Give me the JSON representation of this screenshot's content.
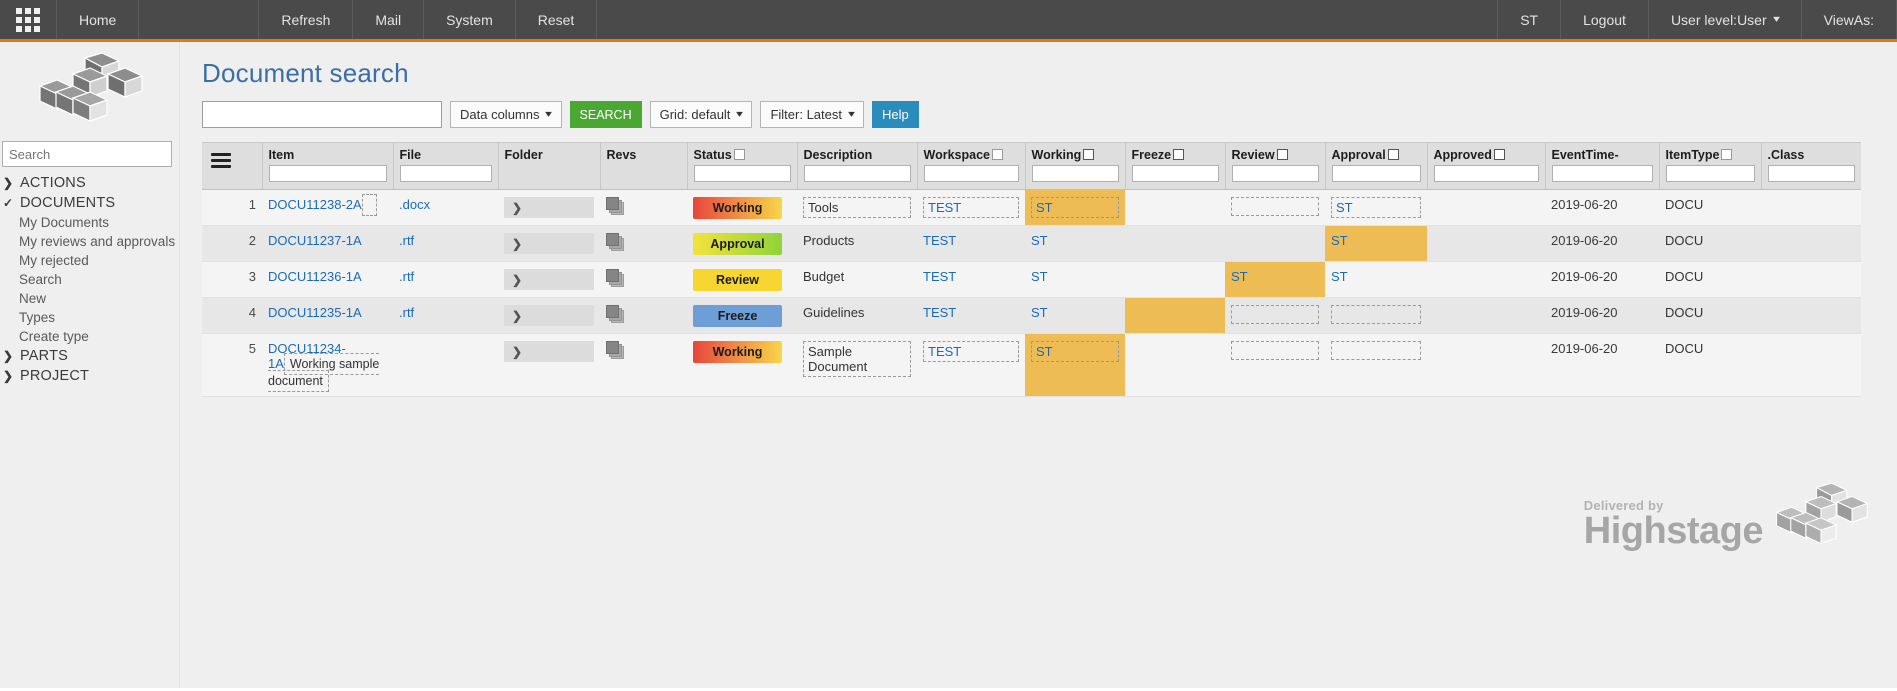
{
  "topbar": {
    "menu_icon": "grid-apps-icon",
    "items": [
      "Home",
      "Refresh",
      "Mail",
      "System",
      "Reset"
    ],
    "right_items": [
      "ST",
      "Logout"
    ],
    "user_level": "User level:User",
    "view_as": "ViewAs:"
  },
  "sidebar": {
    "logo": "highstage-cube-logo",
    "search_placeholder": "Search",
    "search_value": "",
    "groups": [
      {
        "label": "ACTIONS",
        "icon": "chevron-right-icon",
        "expanded": false,
        "items": []
      },
      {
        "label": "DOCUMENTS",
        "icon": "check-icon",
        "expanded": true,
        "items": [
          "My Documents",
          "My reviews and approvals",
          "My rejected",
          "Search",
          "New",
          "Types",
          "Create type"
        ]
      },
      {
        "label": "PARTS",
        "icon": "chevron-right-icon",
        "expanded": false,
        "items": []
      },
      {
        "label": "PROJECT",
        "icon": "chevron-right-icon",
        "expanded": false,
        "items": []
      }
    ]
  },
  "page": {
    "title": "Document search"
  },
  "toolbar": {
    "search_value": "",
    "search_placeholder": "",
    "data_columns": "Data columns",
    "search_button": "SEARCH",
    "grid": "Grid: default",
    "filter": "Filter: Latest",
    "help": "Help"
  },
  "grid": {
    "menu_icon": "hamburger-menu-icon",
    "columns": [
      {
        "label": "Item",
        "checkbox": "none",
        "filter": ""
      },
      {
        "label": "File",
        "checkbox": "none",
        "filter": ""
      },
      {
        "label": "Folder",
        "checkbox": "none",
        "filter": null
      },
      {
        "label": "Revs",
        "checkbox": "none",
        "filter": null
      },
      {
        "label": "Status",
        "checkbox": "small",
        "filter": ""
      },
      {
        "label": "Description",
        "checkbox": "none",
        "filter": ""
      },
      {
        "label": "Workspace",
        "checkbox": "small",
        "filter": ""
      },
      {
        "label": "Working",
        "checkbox": "big",
        "filter": ""
      },
      {
        "label": "Freeze",
        "checkbox": "big",
        "filter": ""
      },
      {
        "label": "Review",
        "checkbox": "big",
        "filter": ""
      },
      {
        "label": "Approval",
        "checkbox": "big",
        "filter": ""
      },
      {
        "label": "Approved",
        "checkbox": "big",
        "filter": ""
      },
      {
        "label": "EventTime-",
        "checkbox": "none",
        "filter": ""
      },
      {
        "label": "ItemType",
        "checkbox": "small",
        "filter": ""
      },
      {
        "label": ".Class",
        "checkbox": "none",
        "filter": ""
      }
    ],
    "rows": [
      {
        "num": "1",
        "item": "DOCU11238-2A",
        "item_sub": "",
        "item_sub_dashed": true,
        "file": ".docx",
        "folder": "folder-expand-icon",
        "revs": "revisions-icon",
        "status": "Working",
        "status_style": "working",
        "description": "Tools",
        "description_dashed": true,
        "workspace": "TEST",
        "workspace_dashed": true,
        "working": "ST",
        "working_hl": true,
        "working_dashed": true,
        "freeze": "",
        "freeze_hl": false,
        "freeze_dashed": false,
        "review": "",
        "review_hl": false,
        "review_dashed": true,
        "approval": "ST",
        "approval_hl": false,
        "approval_dashed": true,
        "approved": "",
        "approved_hl": false,
        "approved_dashed": false,
        "eventtime": "2019-06-20",
        "itemtype": "DOCU",
        "class": ""
      },
      {
        "num": "2",
        "item": "DOCU11237-1A",
        "item_sub": "",
        "item_sub_dashed": false,
        "file": ".rtf",
        "folder": "folder-expand-icon",
        "revs": "revisions-icon",
        "status": "Approval",
        "status_style": "approval",
        "description": "Products",
        "description_dashed": false,
        "workspace": "TEST",
        "workspace_dashed": false,
        "working": "ST",
        "working_hl": false,
        "working_dashed": false,
        "freeze": "",
        "freeze_hl": false,
        "freeze_dashed": false,
        "review": "",
        "review_hl": false,
        "review_dashed": false,
        "approval": "ST",
        "approval_hl": true,
        "approval_dashed": false,
        "approved": "",
        "approved_hl": false,
        "approved_dashed": false,
        "eventtime": "2019-06-20",
        "itemtype": "DOCU",
        "class": ""
      },
      {
        "num": "3",
        "item": "DOCU11236-1A",
        "item_sub": "",
        "item_sub_dashed": false,
        "file": ".rtf",
        "folder": "folder-expand-icon",
        "revs": "revisions-icon",
        "status": "Review",
        "status_style": "review",
        "description": "Budget",
        "description_dashed": false,
        "workspace": "TEST",
        "workspace_dashed": false,
        "working": "ST",
        "working_hl": false,
        "working_dashed": false,
        "freeze": "",
        "freeze_hl": false,
        "freeze_dashed": false,
        "review": "ST",
        "review_hl": true,
        "review_dashed": false,
        "approval": "ST",
        "approval_hl": false,
        "approval_dashed": false,
        "approved": "",
        "approved_hl": false,
        "approved_dashed": false,
        "eventtime": "2019-06-20",
        "itemtype": "DOCU",
        "class": ""
      },
      {
        "num": "4",
        "item": "DOCU11235-1A",
        "item_sub": "",
        "item_sub_dashed": false,
        "file": ".rtf",
        "folder": "folder-expand-icon",
        "revs": "revisions-icon",
        "status": "Freeze",
        "status_style": "freeze",
        "description": "Guidelines",
        "description_dashed": false,
        "workspace": "TEST",
        "workspace_dashed": false,
        "working": "ST",
        "working_hl": false,
        "working_dashed": false,
        "freeze": "",
        "freeze_hl": true,
        "freeze_dashed": false,
        "review": "",
        "review_hl": false,
        "review_dashed": true,
        "approval": "",
        "approval_hl": false,
        "approval_dashed": true,
        "approved": "",
        "approved_hl": false,
        "approved_dashed": false,
        "eventtime": "2019-06-20",
        "itemtype": "DOCU",
        "class": ""
      },
      {
        "num": "5",
        "item": "DOCU11234-1A",
        "item_sub": "Working sample document",
        "item_sub_dashed": true,
        "file": "",
        "folder": "folder-expand-icon",
        "revs": "revisions-icon",
        "status": "Working",
        "status_style": "working",
        "description": "Sample Document",
        "description_dashed": true,
        "workspace": "TEST",
        "workspace_dashed": true,
        "working": "ST",
        "working_hl": true,
        "working_dashed": true,
        "freeze": "",
        "freeze_hl": false,
        "freeze_dashed": false,
        "review": "",
        "review_hl": false,
        "review_dashed": true,
        "approval": "",
        "approval_hl": false,
        "approval_dashed": true,
        "approved": "",
        "approved_hl": false,
        "approved_dashed": false,
        "eventtime": "2019-06-20",
        "itemtype": "DOCU",
        "class": ""
      }
    ]
  },
  "footer": {
    "delivered_by": "Delivered by",
    "brand": "Highstage",
    "logo": "highstage-cube-logo"
  },
  "colors": {
    "accent_orange": "#e07b10",
    "topbar": "#4a4a4a",
    "link": "#1a6bb5",
    "search_green": "#4aa832",
    "help_blue": "#2a8bbd",
    "highlight": "#edbc54",
    "status_working_from": "#e8453c",
    "status_working_to": "#f7d64a",
    "status_approval_from": "#f5e23c",
    "status_approval_to": "#8fd43a",
    "status_review": "#f7d632",
    "status_freeze": "#6d9ed5"
  }
}
